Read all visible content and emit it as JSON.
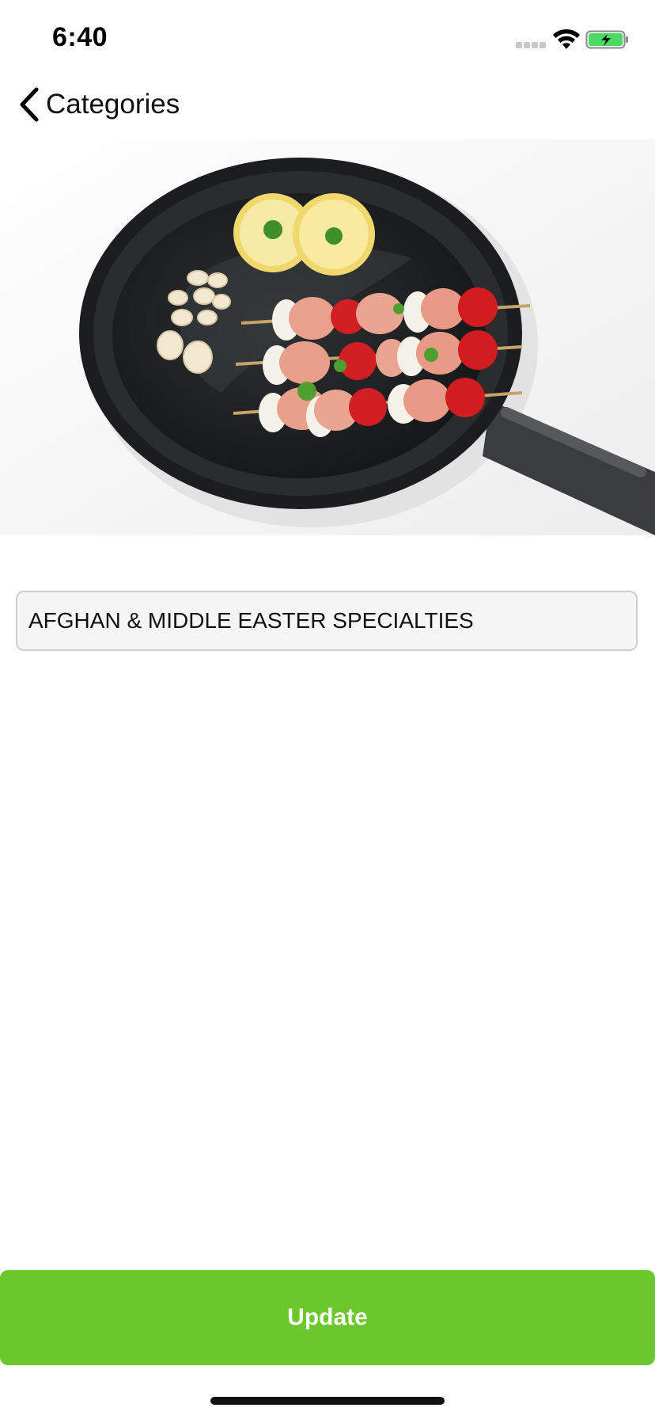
{
  "status_bar": {
    "time": "6:40",
    "icons": [
      "signal-icon",
      "wifi-icon",
      "battery-charging-icon"
    ]
  },
  "nav": {
    "back_label": "Categories",
    "back_icon": "chevron-left-icon"
  },
  "category": {
    "image_subject": "chicken skewers with tomatoes in frying pan",
    "name_value": "AFGHAN & MIDDLE EASTER SPECIALTIES"
  },
  "actions": {
    "update_label": "Update"
  },
  "colors": {
    "accent_green": "#6cc72d",
    "battery_green": "#4cd964"
  }
}
